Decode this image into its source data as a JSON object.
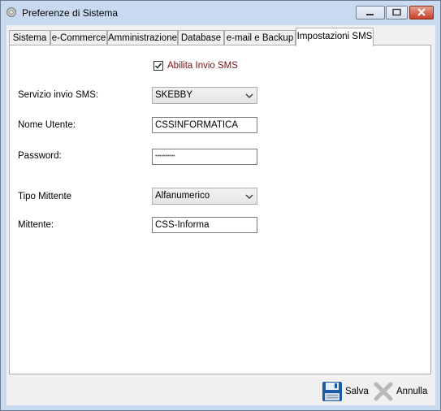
{
  "window": {
    "title": "Preferenze di Sistema"
  },
  "tabs": [
    {
      "label": "Sistema"
    },
    {
      "label": "e-Commerce"
    },
    {
      "label": "Amministrazione"
    },
    {
      "label": "Database"
    },
    {
      "label": "e-mail e Backup"
    },
    {
      "label": "Impostazioni SMS",
      "active": true
    }
  ],
  "sms": {
    "enable_label": "Abilita Invio SMS",
    "enable_checked": true,
    "service_label": "Servizio invio SMS:",
    "service_value": "SKEBBY",
    "username_label": "Nome Utente:",
    "username_value": "CSSINFORMATICA",
    "password_label": "Password:",
    "password_value": "••••••••••",
    "sender_type_label": "Tipo Mittente",
    "sender_type_value": "Alfanumerico",
    "sender_label": "Mittente:",
    "sender_value": "CSS-Informa"
  },
  "footer": {
    "save_label": "Salva",
    "cancel_label": "Annulla"
  },
  "colors": {
    "accent": "#c9daf0",
    "close": "#c4402a",
    "checkbox_label": "#7a1010"
  }
}
